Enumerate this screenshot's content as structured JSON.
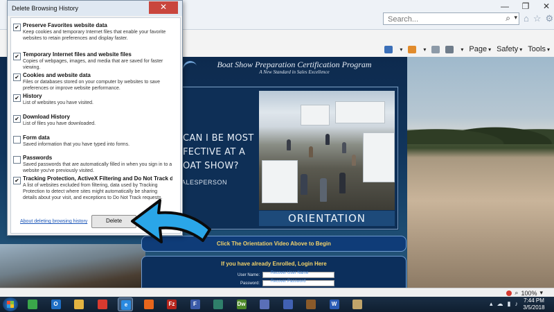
{
  "window": {
    "minimize_glyph": "—",
    "restore_glyph": "❐",
    "close_glyph": "✕"
  },
  "browser": {
    "search_placeholder": "Search...",
    "search_icon": "search-icon",
    "toolbar": {
      "page_label": "Page",
      "safety_label": "Safety",
      "tools_label": "Tools"
    },
    "zoom": "100%"
  },
  "site": {
    "title": "Boat Show Preparation Certification Program",
    "tagline": "A New Standard in Sales Excellence",
    "video_lines": [
      "CAN I BE MOST",
      "FECTIVE AT A",
      "OAT SHOW?"
    ],
    "video_caption": "ALESPERSON",
    "video_banner": "ORIENTATION",
    "cta": "Click The Orientation Video Above to Begin",
    "login": {
      "heading": "If you have already Enrolled, Login Here",
      "username_label": "User Name:",
      "username_recover": "Recover User Name",
      "password_label": "Password:",
      "password_recover": "Recover Password"
    }
  },
  "dialog": {
    "title": "Delete Browsing History",
    "options": [
      {
        "label": "Preserve Favorites website data",
        "desc": "Keep cookies and temporary Internet files that enable your favorite websites to retain preferences and display faster.",
        "checked": true
      },
      {
        "label": "Temporary Internet files and website files",
        "desc": "Copies of webpages, images, and media that are saved for faster viewing.",
        "checked": true
      },
      {
        "label": "Cookies and website data",
        "desc": "Files or databases stored on your computer by websites to save preferences or improve website performance.",
        "checked": true
      },
      {
        "label": "History",
        "desc": "List of websites you have visited.",
        "checked": true
      },
      {
        "label": "Download History",
        "desc": "List of files you have downloaded.",
        "checked": true
      },
      {
        "label": "Form data",
        "desc": "Saved information that you have typed into forms.",
        "checked": false
      },
      {
        "label": "Passwords",
        "desc": "Saved passwords that are automatically filled in when you sign in to a website you've previously visited.",
        "checked": false
      },
      {
        "label": "Tracking Protection, ActiveX Filtering and Do Not Track d",
        "desc": "A list of websites excluded from filtering, data used by Tracking Protection to detect where sites might automatically be sharing details about your visit, and exceptions to Do Not Track requests.",
        "checked": true
      }
    ],
    "link": "About deleting browsing history",
    "delete_label": "Delete"
  },
  "taskbar": {
    "apps": [
      {
        "name": "green-app-icon",
        "glyph": "",
        "color": "#3aa64a"
      },
      {
        "name": "outlook-icon",
        "glyph": "O",
        "color": "#1f6fc5"
      },
      {
        "name": "file-explorer-icon",
        "glyph": "",
        "color": "#e3b341"
      },
      {
        "name": "chrome-icon",
        "glyph": "",
        "color": "#d93a2f"
      },
      {
        "name": "internet-explorer-icon",
        "glyph": "e",
        "color": "#2a8ae0"
      },
      {
        "name": "firefox-icon",
        "glyph": "",
        "color": "#e8661c"
      },
      {
        "name": "filezilla-icon",
        "glyph": "Fz",
        "color": "#b7251d"
      },
      {
        "name": "ftp-app-icon",
        "glyph": "F",
        "color": "#3a5aa8"
      },
      {
        "name": "feather-app-icon",
        "glyph": "",
        "color": "#2f7f6a"
      },
      {
        "name": "dreamweaver-icon",
        "glyph": "Dw",
        "color": "#4e8a2a"
      },
      {
        "name": "blue-app-icon-1",
        "glyph": "",
        "color": "#5a6fb8"
      },
      {
        "name": "blue-app-icon-2",
        "glyph": "",
        "color": "#4161b3"
      },
      {
        "name": "books-icon",
        "glyph": "",
        "color": "#8a5a2a"
      },
      {
        "name": "word-icon",
        "glyph": "W",
        "color": "#2b5bb5"
      },
      {
        "name": "notes-app-icon",
        "glyph": "",
        "color": "#c0a46a"
      }
    ],
    "time": "7:44 PM",
    "date": "3/5/2018"
  }
}
